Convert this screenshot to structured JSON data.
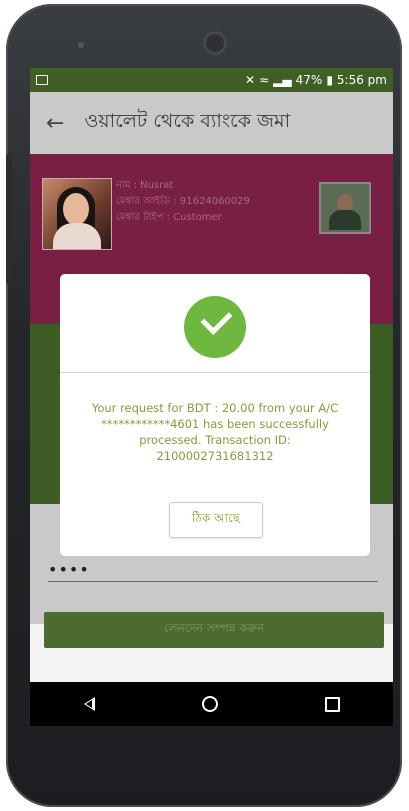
{
  "status_bar": {
    "icons": [
      "image-icon",
      "mute-icon",
      "wifi-icon",
      "signal-icon",
      "signal-icon",
      "battery-icon"
    ],
    "battery": "47%",
    "time": "5:56 pm"
  },
  "app_bar": {
    "title": "ওয়ালেট থেকে ব্যাংকে জমা"
  },
  "profile": {
    "name_line": "নাম : Nusrat",
    "account_line": "মেম্বার আইডি : 91624060029",
    "type_line": "মেম্বার টাইপ : Customer"
  },
  "pin_field": {
    "value": "••••"
  },
  "submit_label": "লেনদেন সম্পন্ন করুন",
  "dialog": {
    "message": "Your request for BDT : 20.00 from your A/C ************4601 has been successfully processed. Transaction ID: 2100002731681312",
    "ok_label": "ঠিক আছে"
  },
  "colors": {
    "status_bar": "#3f5f25",
    "profile_band": "#7a1f44",
    "success_green": "#6fb83f",
    "message_text": "#8a9a3a"
  }
}
